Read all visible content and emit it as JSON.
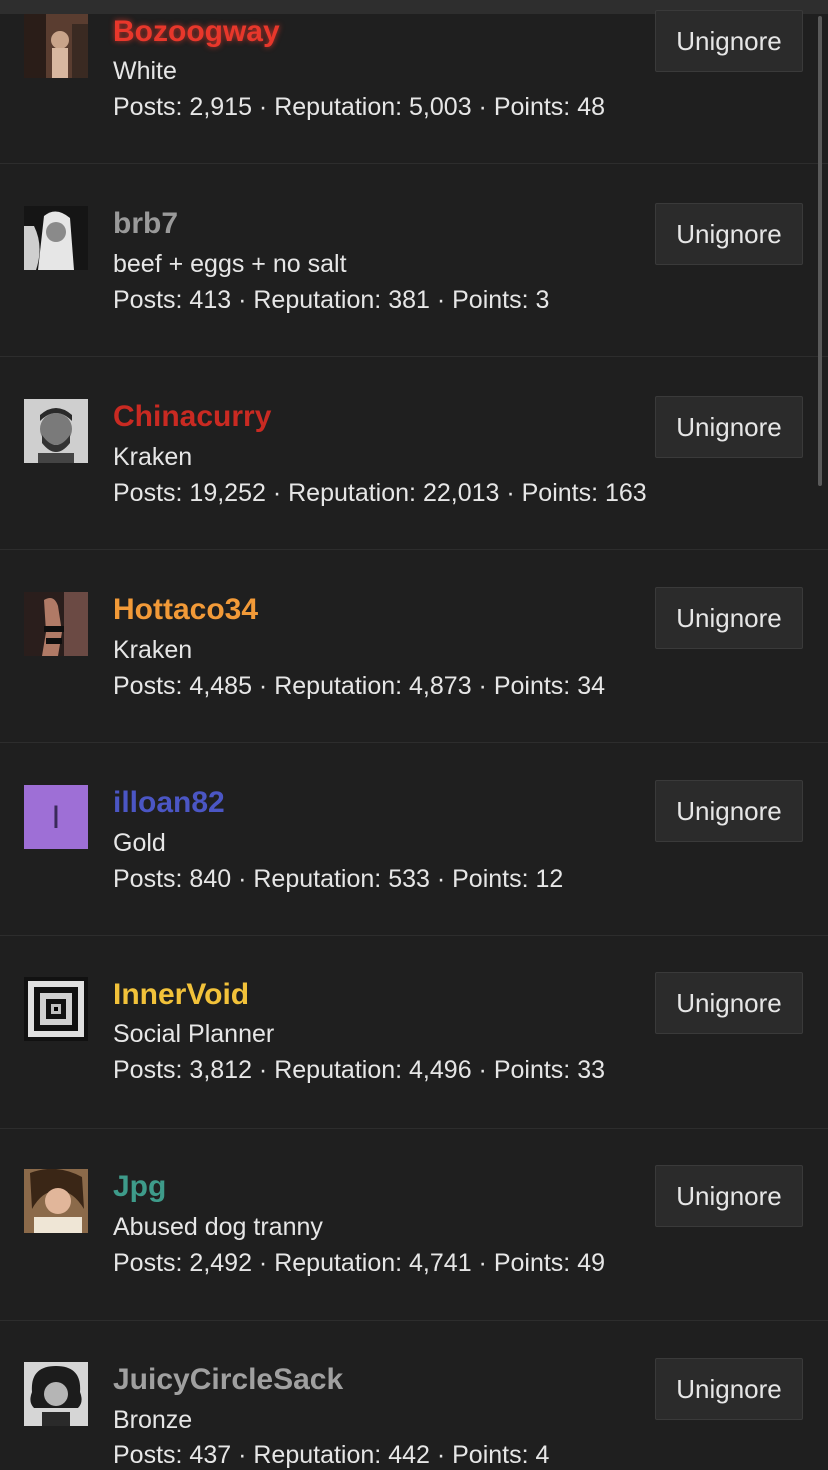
{
  "button_label": "Unignore",
  "sep": " · ",
  "labels": {
    "posts": "Posts: ",
    "reputation": "Reputation: ",
    "points": "Points: "
  },
  "users": [
    {
      "name": "Bozoogway",
      "color": "#e8372b",
      "title": "White",
      "posts": "2,915",
      "reputation": "5,003",
      "points": "48",
      "avatar": "photo-avatar"
    },
    {
      "name": "brb7",
      "color": "#9a9a9a",
      "title": "beef + eggs + no salt",
      "posts": "413",
      "reputation": "381",
      "points": "3",
      "avatar": "photo-avatar"
    },
    {
      "name": "Chinacurry",
      "color": "#c92a22",
      "title": "Kraken",
      "posts": "19,252",
      "reputation": "22,013",
      "points": "163",
      "avatar": "photo-avatar"
    },
    {
      "name": "Hottaco34",
      "color": "#f29a38",
      "title": "Kraken",
      "posts": "4,485",
      "reputation": "4,873",
      "points": "34",
      "avatar": "photo-avatar"
    },
    {
      "name": "illoan82",
      "color": "#4b56c4",
      "title": "Gold",
      "posts": "840",
      "reputation": "533",
      "points": "12",
      "avatar": "letter-avatar",
      "avatar_letter": "I",
      "avatar_bg": "#9e6fd6"
    },
    {
      "name": "InnerVoid",
      "color": "#f2c23a",
      "title": "Social Planner",
      "posts": "3,812",
      "reputation": "4,496",
      "points": "33",
      "avatar": "tunnel-avatar"
    },
    {
      "name": "Jpg",
      "color": "#3e9b8a",
      "title": "Abused dog tranny",
      "posts": "2,492",
      "reputation": "4,741",
      "points": "49",
      "avatar": "photo-avatar"
    },
    {
      "name": "JuicyCircleSack",
      "color": "#a0a0a0",
      "title": "Bronze",
      "posts": "437",
      "reputation": "442",
      "points": "4",
      "avatar": "photo-avatar"
    }
  ]
}
